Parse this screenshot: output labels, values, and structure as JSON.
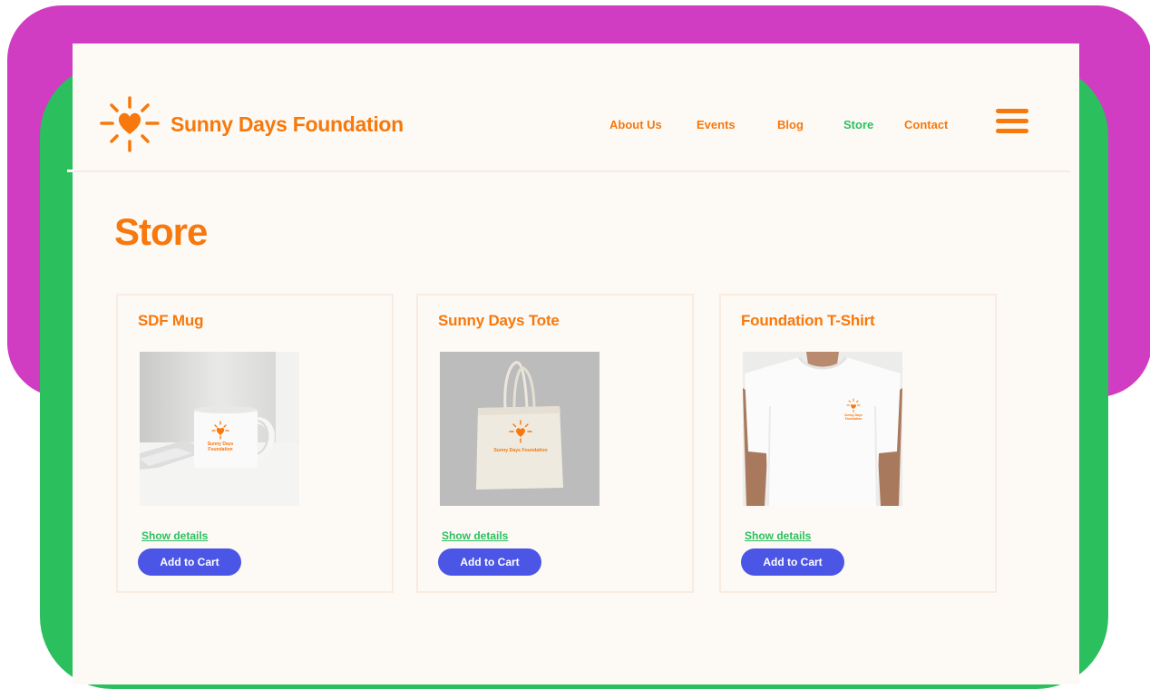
{
  "brand": {
    "name": "Sunny Days Foundation",
    "logo_icon": "sun-heart-icon",
    "color_primary": "#f7780c",
    "color_accent": "#2cbf5e",
    "color_button": "#4b55e6"
  },
  "nav": {
    "items": [
      {
        "label": "About Us",
        "active": false
      },
      {
        "label": "Events",
        "active": false
      },
      {
        "label": "Blog",
        "active": false
      },
      {
        "label": "Store",
        "active": true
      },
      {
        "label": "Contact",
        "active": false
      }
    ],
    "menu_icon": "hamburger-menu-icon"
  },
  "page": {
    "title": "Store"
  },
  "products": [
    {
      "name": "SDF Mug",
      "image": "mug-photo",
      "print_line1": "Sunny Days",
      "print_line2": "Foundation",
      "details_label": "Show details",
      "cart_label": "Add to Cart"
    },
    {
      "name": "Sunny Days Tote",
      "image": "tote-bag-photo",
      "print_line1": "Sunny Days Foundation",
      "print_line2": "",
      "details_label": "Show details",
      "cart_label": "Add to Cart"
    },
    {
      "name": "Foundation T-Shirt",
      "image": "t-shirt-photo",
      "print_line1": "Sunny Days",
      "print_line2": "Foundation",
      "details_label": "Show details",
      "cart_label": "Add to Cart"
    }
  ]
}
